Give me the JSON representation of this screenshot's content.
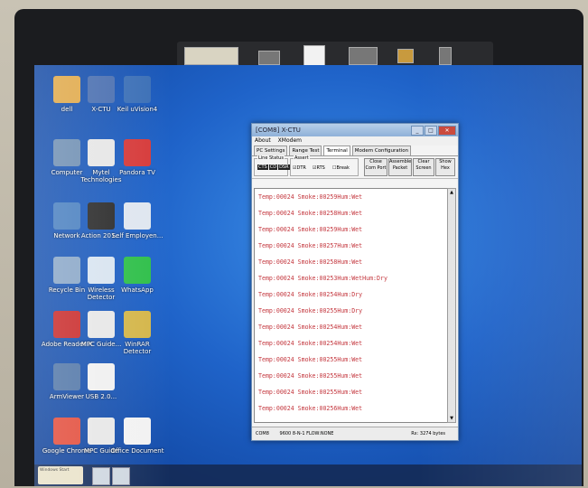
{
  "desktop": {
    "icons": [
      {
        "label": "dell",
        "color": "#e0a94a"
      },
      {
        "label": "X-CTU",
        "color": "#4a6fb0"
      },
      {
        "label": "Keil uVision4",
        "color": "#3b6fb6"
      },
      {
        "label": "Computer",
        "color": "#6f8fb3"
      },
      {
        "label": "Mytel Technologies",
        "color": "#e6e6e6"
      },
      {
        "label": "Pandora TV",
        "color": "#d63a3a"
      },
      {
        "label": "Network",
        "color": "#4a80c0"
      },
      {
        "label": "Action 201...",
        "color": "#2b2b2b"
      },
      {
        "label": "Self Employen...",
        "color": "#dfe6ef"
      },
      {
        "label": "Recycle Bin",
        "color": "#8aa7c8"
      },
      {
        "label": "Wireless Detector",
        "color": "#d8e4f0"
      },
      {
        "label": "WhatsApp",
        "color": "#2fbf4a"
      },
      {
        "label": "Adobe Reader X",
        "color": "#c92b2b"
      },
      {
        "label": "MPC Guide...",
        "color": "#e7e7e7"
      },
      {
        "label": "WinRAR Detector",
        "color": "#d4b64a"
      },
      {
        "label": "ArmViewer",
        "color": "#5277a8"
      },
      {
        "label": "USB 2.0...",
        "color": "#f0f0f0"
      },
      {
        "label": "Google Chrome",
        "color": "#e34d3c"
      },
      {
        "label": "MPC Guide",
        "color": "#e7e7e7"
      },
      {
        "label": "Office Document",
        "color": "#f2f2f2"
      }
    ]
  },
  "window": {
    "title": "[COM8] X-CTU",
    "menu": [
      "About",
      "XModem"
    ],
    "tabs": [
      "PC Settings",
      "Range Test",
      "Terminal",
      "Modem Configuration"
    ],
    "line_status_label": "Line Status",
    "leds": [
      "CTS",
      "CD",
      "DSR"
    ],
    "assert_label": "Assert",
    "checks": [
      "DTR",
      "RTS",
      "Break"
    ],
    "buttons": [
      "Close Com Port",
      "Assemble Packet",
      "Clear Screen",
      "Show Hex"
    ],
    "lines": [
      "Temp:00024  Smoke:00259Hum:Wet",
      "Temp:00024  Smoke:00258Hum:Wet",
      "Temp:00024  Smoke:00259Hum:Wet",
      "Temp:00024  Smoke:00257Hum:Wet",
      "Temp:00024  Smoke:00258Hum:Wet",
      "Temp:00024  Smoke:00253Hum:WetHum:Dry",
      "Temp:00024  Smoke:00254Hum:Dry",
      "Temp:00024  Smoke:00255Hum:Dry",
      "Temp:00024  Smoke:00254Hum:Wet",
      "Temp:00024  Smoke:00254Hum:Wet",
      "Temp:00024  Smoke:00255Hum:Wet",
      "Temp:00024  Smoke:00255Hum:Wet",
      "Temp:00024  Smoke:00255Hum:Wet",
      "Temp:00024  Smoke:00256Hum:Wet"
    ],
    "status_port": "COM8",
    "status_settings": "9600 8-N-1  FLOW:NONE",
    "status_rx": "Rx: 3274 bytes"
  },
  "taskbar": {
    "start_text": "Windows Start"
  }
}
